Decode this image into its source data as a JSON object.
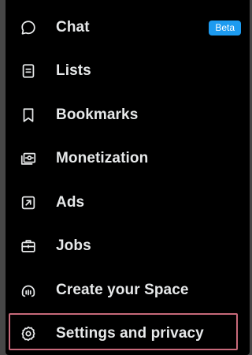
{
  "menu": {
    "items": [
      {
        "label": "Chat",
        "icon": "chat-bubble-icon",
        "badge": "Beta"
      },
      {
        "label": "Lists",
        "icon": "list-icon"
      },
      {
        "label": "Bookmarks",
        "icon": "bookmark-icon"
      },
      {
        "label": "Monetization",
        "icon": "money-icon"
      },
      {
        "label": "Ads",
        "icon": "external-arrow-icon"
      },
      {
        "label": "Jobs",
        "icon": "briefcase-icon"
      },
      {
        "label": "Create your Space",
        "icon": "microphone-icon"
      },
      {
        "label": "Settings and privacy",
        "icon": "gear-icon"
      }
    ],
    "highlighted_item": "Settings and privacy"
  },
  "colors": {
    "background": "#000000",
    "text": "#e7e9ea",
    "badge": "#1d9bf0",
    "highlight_border": "#c7697a"
  }
}
